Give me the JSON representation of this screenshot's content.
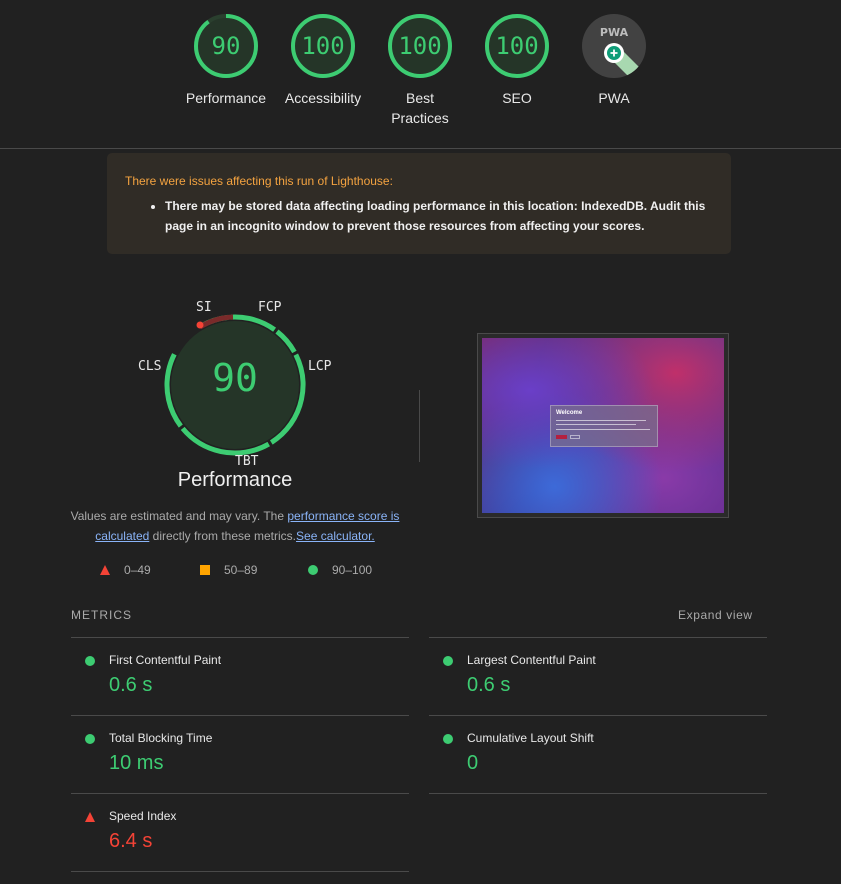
{
  "header_gauges": [
    {
      "score": "90",
      "label": "Performance"
    },
    {
      "score": "100",
      "label": "Accessibility"
    },
    {
      "score": "100",
      "label": "Best Practices"
    },
    {
      "score": "100",
      "label": "SEO"
    },
    {
      "score": "",
      "label": "PWA"
    }
  ],
  "warning": {
    "title": "There were issues affecting this run of Lighthouse:",
    "item": "There may be stored data affecting loading performance in this location: IndexedDB. Audit this page in an incognito window to prevent those resources from affecting your scores."
  },
  "performance": {
    "score": "90",
    "title": "Performance",
    "metric_labels": {
      "si": "SI",
      "fcp": "FCP",
      "lcp": "LCP",
      "tbt": "TBT",
      "cls": "CLS"
    },
    "note_prefix": "Values are estimated and may vary. The ",
    "note_link1": "performance score is calculated",
    "note_mid": " directly from these metrics.",
    "note_link2": "See calculator."
  },
  "screenshot": {
    "dialog_title": "Welcome"
  },
  "legend": {
    "fail": "0–49",
    "average": "50–89",
    "pass": "90–100"
  },
  "metrics": {
    "heading": "METRICS",
    "expand": "Expand view",
    "left": [
      {
        "name": "First Contentful Paint",
        "value": "0.6 s",
        "status": "pass"
      },
      {
        "name": "Total Blocking Time",
        "value": "10 ms",
        "status": "pass"
      },
      {
        "name": "Speed Index",
        "value": "6.4 s",
        "status": "fail"
      }
    ],
    "right": [
      {
        "name": "Largest Contentful Paint",
        "value": "0.6 s",
        "status": "pass"
      },
      {
        "name": "Cumulative Layout Shift",
        "value": "0",
        "status": "pass"
      }
    ]
  },
  "colors": {
    "pass": "#3dcc72",
    "average": "#ffa400",
    "fail": "#f44336"
  }
}
